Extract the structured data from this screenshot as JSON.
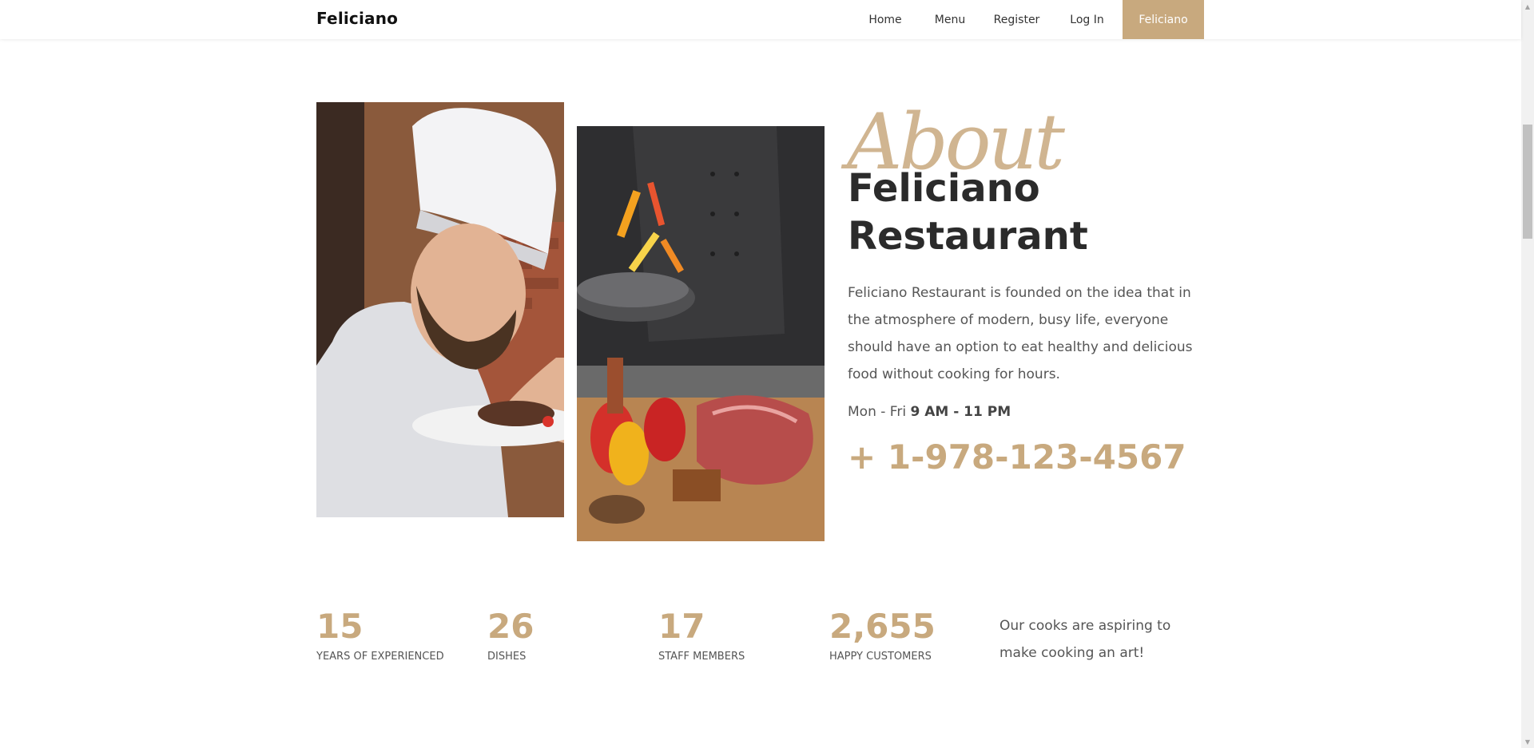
{
  "navbar": {
    "brand": "Feliciano",
    "items": [
      {
        "label": "Home"
      },
      {
        "label": "Menu"
      },
      {
        "label": "Register"
      },
      {
        "label": "Log In"
      },
      {
        "label": "Feliciano",
        "active": true
      }
    ]
  },
  "about": {
    "script_title": "About",
    "heading": "Feliciano Restaurant",
    "description": "Feliciano Restaurant is founded on the idea that in the atmosphere of modern, busy life, everyone should have an option to eat healthy and delicious food without cooking for hours.",
    "hours_prefix": "Mon - Fri",
    "hours_value": "9 AM - 11 PM",
    "phone": "+ 1-978-123-4567"
  },
  "images": {
    "left": "chef-plating-photo",
    "right": "cook-tossing-vegetables-photo"
  },
  "stats": [
    {
      "number": "15",
      "label": "YEARS OF EXPERIENCED"
    },
    {
      "number": "26",
      "label": "DISHES"
    },
    {
      "number": "17",
      "label": "STAFF MEMBERS"
    },
    {
      "number": "2,655",
      "label": "HAPPY CUSTOMERS"
    }
  ],
  "tagline": "Our cooks are aspiring to make cooking an art!",
  "colors": {
    "accent": "#c8a97e",
    "heading": "#2b2b2b",
    "body_text": "#555555"
  }
}
